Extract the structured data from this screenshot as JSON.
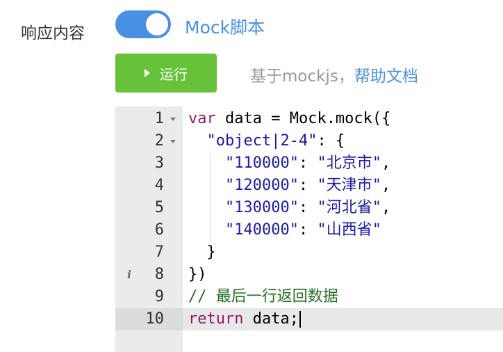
{
  "response": {
    "label": "响应内容",
    "toggle_label": "Mock脚本",
    "toggle_on": true
  },
  "run": {
    "label": "运行",
    "hint_prefix": "基于mockjs，",
    "help_link": "帮助文档"
  },
  "editor": {
    "active_line": 10,
    "lines": [
      {
        "num": "1",
        "fold": true,
        "info": false,
        "tokens": [
          [
            "kw",
            "var"
          ],
          [
            "plain",
            " data = Mock.mock({"
          ]
        ]
      },
      {
        "num": "2",
        "fold": true,
        "info": false,
        "tokens": [
          [
            "plain",
            "  "
          ],
          [
            "str",
            "\"object|2-4\""
          ],
          [
            "plain",
            ": {"
          ]
        ]
      },
      {
        "num": "3",
        "fold": false,
        "info": false,
        "tokens": [
          [
            "plain",
            "    "
          ],
          [
            "str",
            "\"110000\""
          ],
          [
            "plain",
            ": "
          ],
          [
            "str",
            "\"北京市\""
          ],
          [
            "plain",
            ","
          ]
        ]
      },
      {
        "num": "4",
        "fold": false,
        "info": false,
        "tokens": [
          [
            "plain",
            "    "
          ],
          [
            "str",
            "\"120000\""
          ],
          [
            "plain",
            ": "
          ],
          [
            "str",
            "\"天津市\""
          ],
          [
            "plain",
            ","
          ]
        ]
      },
      {
        "num": "5",
        "fold": false,
        "info": false,
        "tokens": [
          [
            "plain",
            "    "
          ],
          [
            "str",
            "\"130000\""
          ],
          [
            "plain",
            ": "
          ],
          [
            "str",
            "\"河北省\""
          ],
          [
            "plain",
            ","
          ]
        ]
      },
      {
        "num": "6",
        "fold": false,
        "info": false,
        "tokens": [
          [
            "plain",
            "    "
          ],
          [
            "str",
            "\"140000\""
          ],
          [
            "plain",
            ": "
          ],
          [
            "str",
            "\"山西省\""
          ]
        ]
      },
      {
        "num": "7",
        "fold": false,
        "info": false,
        "tokens": [
          [
            "plain",
            "  }"
          ]
        ]
      },
      {
        "num": "8",
        "fold": false,
        "info": true,
        "tokens": [
          [
            "plain",
            "})"
          ]
        ]
      },
      {
        "num": "9",
        "fold": false,
        "info": false,
        "tokens": [
          [
            "cmt",
            "// 最后一行返回数据"
          ]
        ]
      },
      {
        "num": "10",
        "fold": false,
        "info": false,
        "tokens": [
          [
            "kw",
            "return"
          ],
          [
            "plain",
            " data;"
          ]
        ]
      }
    ]
  },
  "colors": {
    "toggle": "#4a90e2",
    "run_button": "#67c23a",
    "link": "#4a90e2",
    "keyword": "#931a68",
    "string": "#1a1aa6",
    "comment": "#236e24"
  },
  "icons": {
    "run": "play-triangle-icon",
    "fold": "fold-arrow-icon",
    "info": "info-icon"
  }
}
